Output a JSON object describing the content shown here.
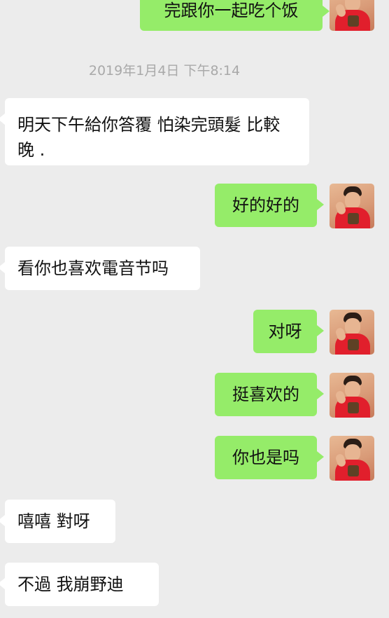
{
  "chat": {
    "timestamp": "2019年1月4日 下午8:14",
    "messages": [
      {
        "side": "out",
        "text": "完跟你一起吃个饭"
      },
      {
        "side": "in",
        "text": "明天下午給你答覆 怕染完頭髮 比較晚 ."
      },
      {
        "side": "out",
        "text": "好的好的"
      },
      {
        "side": "in",
        "text": "看你也喜欢電音节吗"
      },
      {
        "side": "out",
        "text": "对呀"
      },
      {
        "side": "out",
        "text": "挺喜欢的"
      },
      {
        "side": "out",
        "text": "你也是吗"
      },
      {
        "side": "in",
        "text": "嘻嘻 對呀"
      },
      {
        "side": "in",
        "text": "不過 我崩野迪"
      }
    ]
  },
  "colors": {
    "background": "#ececec",
    "incoming_bubble": "#ffffff",
    "outgoing_bubble": "#95ec69",
    "timestamp_text": "#a9a9a9"
  },
  "icons": {
    "avatar": "user-avatar-photo"
  }
}
